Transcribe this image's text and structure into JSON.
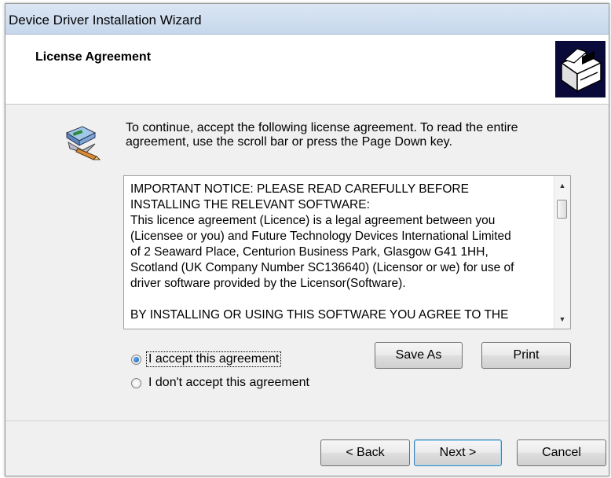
{
  "window": {
    "title": "Device Driver Installation Wizard"
  },
  "header": {
    "title": "License Agreement",
    "logo_icon": "driver-install-logo-icon"
  },
  "intro": {
    "icon": "license-agreement-icon",
    "line1": "To continue, accept the following license agreement. To read the entire",
    "line2": "agreement, use the scroll bar or press the Page Down key."
  },
  "license": {
    "lines": [
      "IMPORTANT NOTICE: PLEASE READ CAREFULLY BEFORE",
      "INSTALLING THE RELEVANT SOFTWARE:",
      "This licence agreement (Licence) is a legal agreement between you",
      "(Licensee or you) and Future Technology Devices International Limited",
      "of 2 Seaward Place, Centurion Business Park, Glasgow G41 1HH,",
      "Scotland (UK Company Number SC136640) (Licensor or we) for use of",
      "driver software provided by the Licensor(Software).",
      "BY INSTALLING OR USING THIS SOFTWARE YOU AGREE TO THE"
    ]
  },
  "buttons": {
    "save_as": "Save As",
    "print": "Print",
    "back": "< Back",
    "next": "Next >",
    "cancel": "Cancel"
  },
  "radios": {
    "accept": {
      "label": "I accept this agreement",
      "checked": true
    },
    "decline": {
      "label": "I don't accept this agreement",
      "checked": false
    }
  },
  "colors": {
    "header_logo_bg": "#0a0a3a",
    "default_button_border": "#3c7fb1"
  }
}
